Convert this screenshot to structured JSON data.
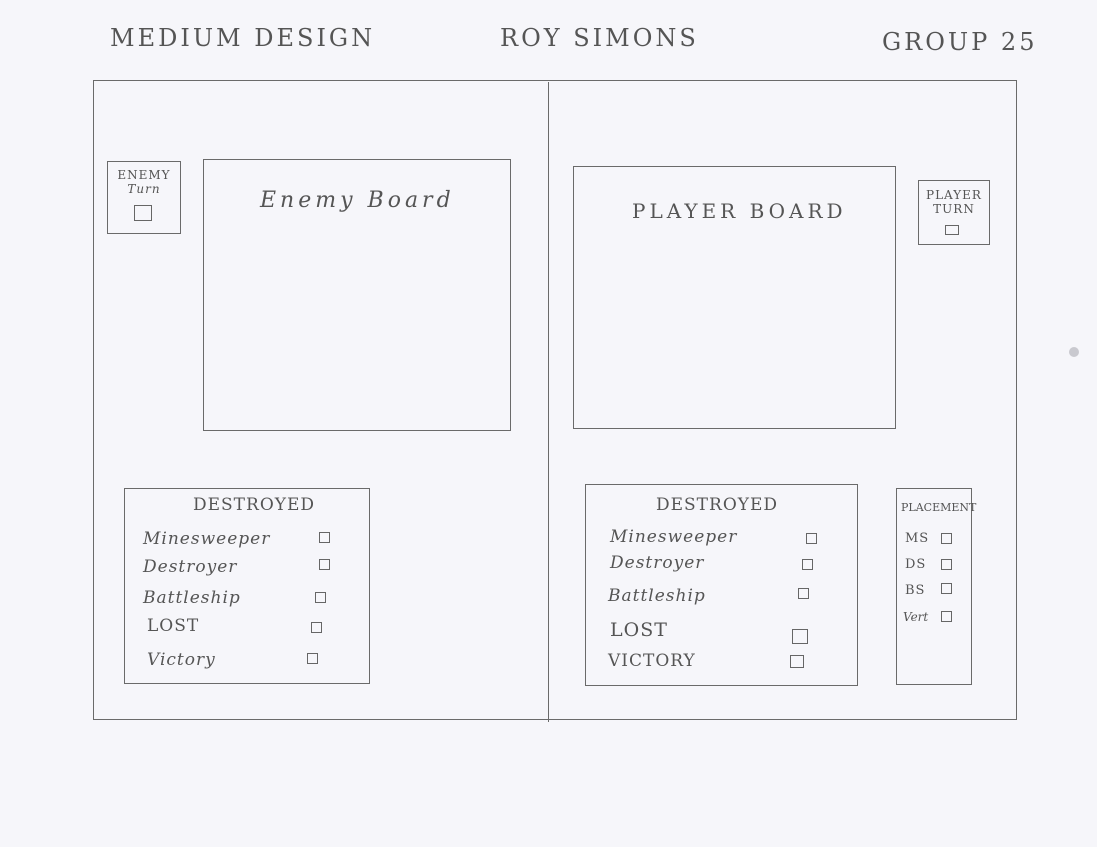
{
  "header": {
    "left": "MEDIUM DESIGN",
    "center": "ROY SIMONS",
    "right": "GROUP 25"
  },
  "enemy_side": {
    "turn_label_line1": "ENEMY",
    "turn_label_line2": "Turn",
    "board_label": "Enemy Board",
    "destroyed": {
      "title": "DESTROYED",
      "items": [
        "Minesweeper",
        "Destroyer",
        "Battleship",
        "LOST",
        "Victory"
      ]
    }
  },
  "player_side": {
    "turn_label_line1": "PLAYER",
    "turn_label_line2": "TURN",
    "board_label": "PLAYER BOARD",
    "destroyed": {
      "title": "DESTROYED",
      "items": [
        "Minesweeper",
        "Destroyer",
        "Battleship",
        "LOST",
        "VICTORY"
      ]
    },
    "placement": {
      "title": "PLACEMENT",
      "items": [
        "MS",
        "DS",
        "BS",
        "Vert"
      ]
    }
  }
}
